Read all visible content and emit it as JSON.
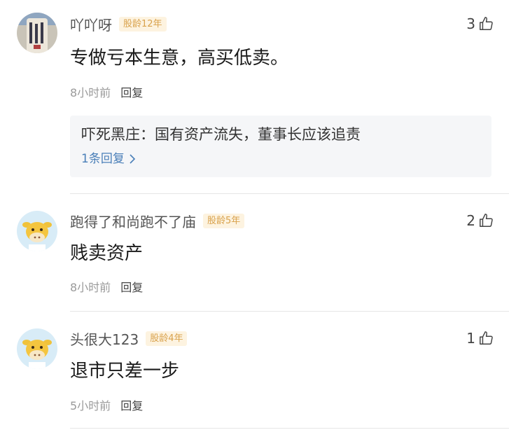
{
  "comments": [
    {
      "username": "吖吖呀",
      "badge": "股龄12年",
      "likes": "3",
      "content": "专做亏本生意，高买低卖。",
      "time": "8小时前",
      "reply_label": "回复",
      "reply_preview": {
        "text": "吓死黑庄：国有资产流失，董事长应该追责",
        "more": "1条回复"
      },
      "avatar_icon": "photo-avatar-icon"
    },
    {
      "username": "跑得了和尚跑不了庙",
      "badge": "股龄5年",
      "likes": "2",
      "content": "贱卖资产",
      "time": "8小时前",
      "reply_label": "回复",
      "avatar_icon": "cow-avatar-icon"
    },
    {
      "username": "头很大123",
      "badge": "股龄4年",
      "likes": "1",
      "content": "退市只差一步",
      "time": "5小时前",
      "reply_label": "回复",
      "avatar_icon": "cow-avatar-icon"
    }
  ],
  "colors": {
    "badge_bg": "#fdf3e0",
    "badge_text": "#d9a24c",
    "link": "#4a7fb8",
    "reply_box_bg": "#f5f6f8"
  }
}
